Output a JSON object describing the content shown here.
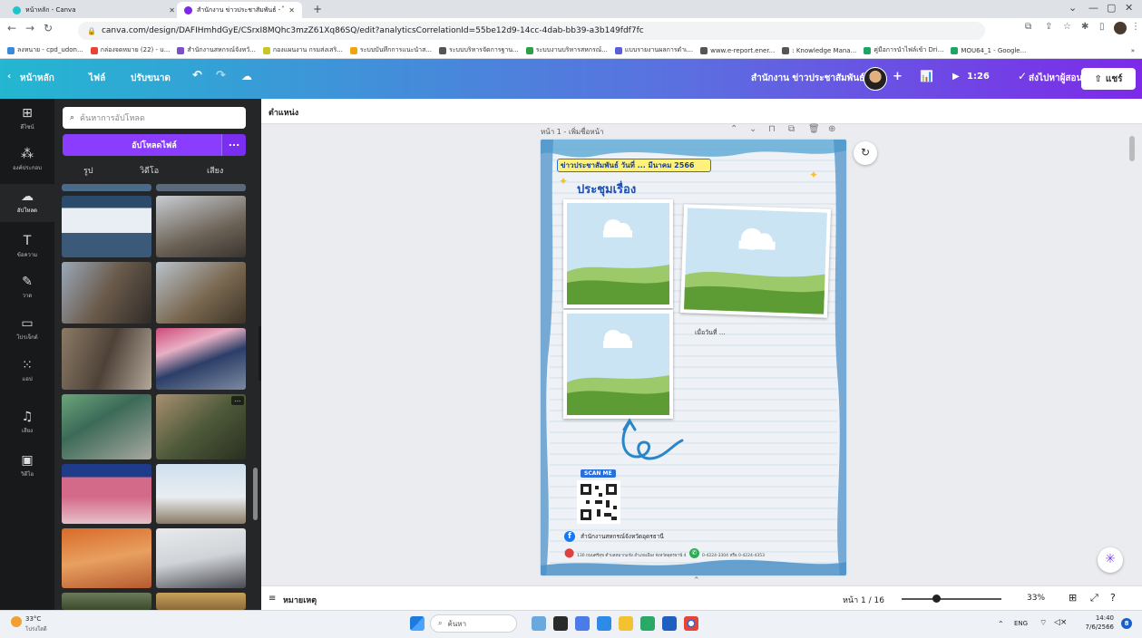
{
  "browser": {
    "tabs": [
      {
        "title": "หน้าหลัก - Canva",
        "active": false
      },
      {
        "title": "สำนักงาน ข่าวประชาสัมพันธ์ - ไปสเล",
        "active": true
      }
    ],
    "url": "canva.com/design/DAFIHmhdGyE/CSrxI8MQhc3mzZ61Xq86SQ/edit?analyticsCorrelationId=55be12d9-14cc-4dab-bb39-a3b149fdf7fc",
    "bookmarks": [
      "ลงหนาย - cpd_udon...",
      "กล่องจดหมาย (22) - u...",
      "สำนักงานสหกรณ์จังหวั...",
      "กองแผนงาน กรมส่งเสริ...",
      "ระบบบันทึกการแนะนำส...",
      "ระบบบริหารจัดการฐาน...",
      "ระบบงานบริหารสหกรณ์...",
      "แบบรายงานผลการดำเ...",
      "www.e-report.ener...",
      ": Knowledge Mana...",
      "คู่มือการนำไฟล์เข้า Dri...",
      "MOU64_1 - Google..."
    ],
    "more_bookmarks": "»"
  },
  "topbar": {
    "home": "หน้าหลัก",
    "file": "ไฟล์",
    "resize": "ปรับขนาด",
    "doc_title": "สำนักงาน ข่าวประชาสัมพันธ์",
    "present_time": "1:26",
    "send_to_teacher": "ส่งไปหาผู้สอน",
    "share": "แชร์"
  },
  "rail": [
    {
      "label": "ดีไซน์",
      "icon": "template-icon"
    },
    {
      "label": "องค์ประกอบ",
      "icon": "elements-icon"
    },
    {
      "label": "อัปโหลด",
      "icon": "upload-icon",
      "selected": true
    },
    {
      "label": "ข้อความ",
      "icon": "text-icon"
    },
    {
      "label": "วาด",
      "icon": "draw-icon"
    },
    {
      "label": "โปรเจ็กต์",
      "icon": "folder-icon"
    },
    {
      "label": "แอป",
      "icon": "apps-icon"
    },
    {
      "label": "เสียง",
      "icon": "audio-icon"
    },
    {
      "label": "วิดีโอ",
      "icon": "video-icon"
    }
  ],
  "panel": {
    "search_placeholder": "ค้นหาการอัปโหลด",
    "upload_button": "อัปโหลดไฟล์",
    "upload_more": "...",
    "tabs": [
      "รูป",
      "วิดีโอ",
      "เสียง"
    ],
    "thumb_more": "..."
  },
  "editor": {
    "position": "ตำแหน่ง",
    "page_header": "หน้า 1 - เพิ่มชื่อหน้า",
    "notes": "หมายเหตุ",
    "page_count": "หน้า 1 / 16",
    "zoom": "33%"
  },
  "design": {
    "banner": "ข่าวประชาสัมพันธ์ วันที่ ... มีนาคม 2566",
    "heading": "ประชุมเรื่อง",
    "date_label": "เมื่อวันที่ ...",
    "scan_me": "SCAN ME",
    "facebook_name": "สำนักงานสหกรณ์จังหวัดอุดรธานี",
    "address": "130 ถนนศรีสุข ตำบลหมากแข้ง อำเภอเมือง จังหวัดอุดรธานี 41000",
    "phone": "0-4224-3304 หรือ 0-4224-4353"
  },
  "taskbar": {
    "temperature": "33°C",
    "weather": "โปร่งใสดี",
    "search": "ค้นหา",
    "lang": "ENG",
    "time": "14:40",
    "date": "7/6/2566"
  },
  "colors": {
    "accent": "#8b3dff",
    "banner": "#2a6fdb"
  }
}
